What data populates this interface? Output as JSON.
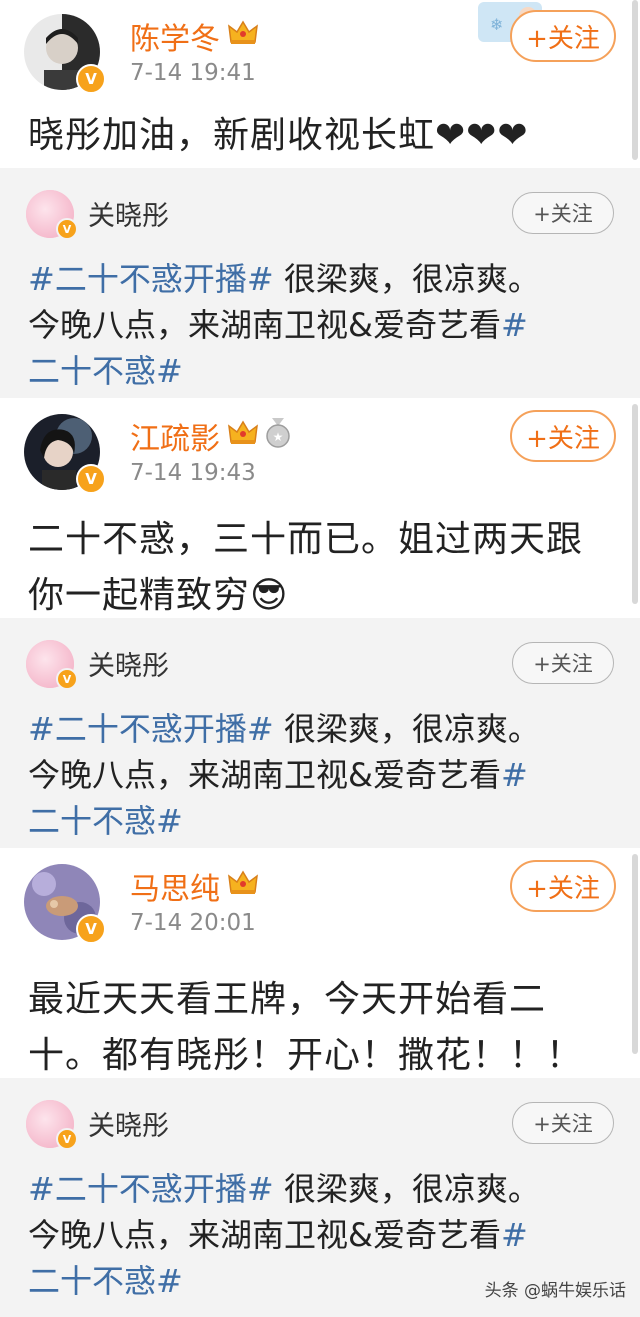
{
  "posts": [
    {
      "author": "陈学冬",
      "time": "7-14 19:41",
      "follow_label": "+关注",
      "text_lines": [
        "晓彤加油，新剧收视长虹❤❤❤"
      ],
      "repost": {
        "author": "关晓彤",
        "follow_label": "+关注",
        "hashtag1": "#二十不惑开播#",
        "line1_rest": " 很梁爽，很凉爽。",
        "line2": "今晚八点，来湖南卫视&爱奇艺看",
        "hashtag2a": "#",
        "hashtag2b": "二十不惑#"
      }
    },
    {
      "author": "江疏影",
      "time": "7-14 19:43",
      "follow_label": "+关注",
      "text_lines": [
        "二十不惑，三十而已。姐过两天跟",
        "你一起精致穷😎"
      ],
      "repost": {
        "author": "关晓彤",
        "follow_label": "+关注",
        "hashtag1": "#二十不惑开播#",
        "line1_rest": " 很梁爽，很凉爽。",
        "line2": "今晚八点，来湖南卫视&爱奇艺看",
        "hashtag2a": "#",
        "hashtag2b": "二十不惑#"
      }
    },
    {
      "author": "马思纯",
      "time": "7-14 20:01",
      "follow_label": "+关注",
      "text_lines": [
        "最近天天看王牌，今天开始看二",
        "十。都有晓彤！开心！撒花！！！"
      ],
      "repost": {
        "author": "关晓彤",
        "follow_label": "+关注",
        "hashtag1": "#二十不惑开播#",
        "line1_rest": " 很梁爽，很凉爽。",
        "line2": "今晚八点，来湖南卫视&爱奇艺看",
        "hashtag2a": "#",
        "hashtag2b": "二十不惑#"
      }
    }
  ],
  "watermark": "头条 @蜗牛娱乐话",
  "colors": {
    "username": "#f06f16",
    "hashtag": "#3f6ea6",
    "verified": "#f7a21b"
  },
  "icons": [
    "crown-icon",
    "verified-badge-icon",
    "plus-icon",
    "medal-icon"
  ]
}
